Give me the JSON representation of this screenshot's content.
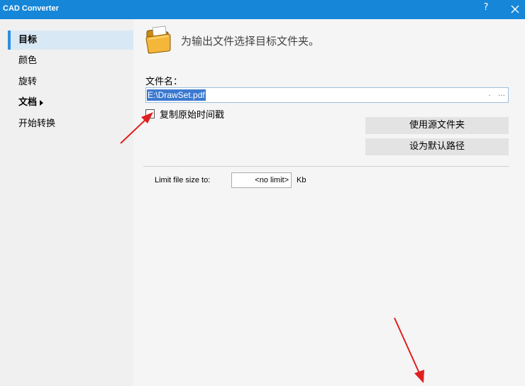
{
  "window": {
    "title": "CAD Converter",
    "help_label": "?"
  },
  "sidebar": {
    "items": [
      {
        "label": "目标",
        "active": true
      },
      {
        "label": "颜色"
      },
      {
        "label": "旋转"
      },
      {
        "label": "文档"
      },
      {
        "label": "开始转换"
      }
    ]
  },
  "main": {
    "heading": "为输出文件选择目标文件夹。",
    "filename_label": "文件名：",
    "filename_value": "E:\\DrawSet.pdf",
    "dot_button": ".",
    "browse_button": "...",
    "checkbox_label": "复制原始时间戳",
    "checkbox_checked": false,
    "use_source_folder_button": "使用源文件夹",
    "set_default_path_button": "设为默认路径",
    "limit_label": "Limit file size to:",
    "limit_value": "<no limit>",
    "limit_unit": "Kb"
  },
  "colors": {
    "titlebar": "#1686d8",
    "sidebar_bg": "#f0f0f0",
    "active_item_bg": "#d9e8f5",
    "accent": "#2f8ee0",
    "annotation_arrow": "#e02020"
  },
  "icons": [
    "folder-icon",
    "close-icon",
    "help-icon",
    "caret-right-icon",
    "arrow-annotation"
  ]
}
